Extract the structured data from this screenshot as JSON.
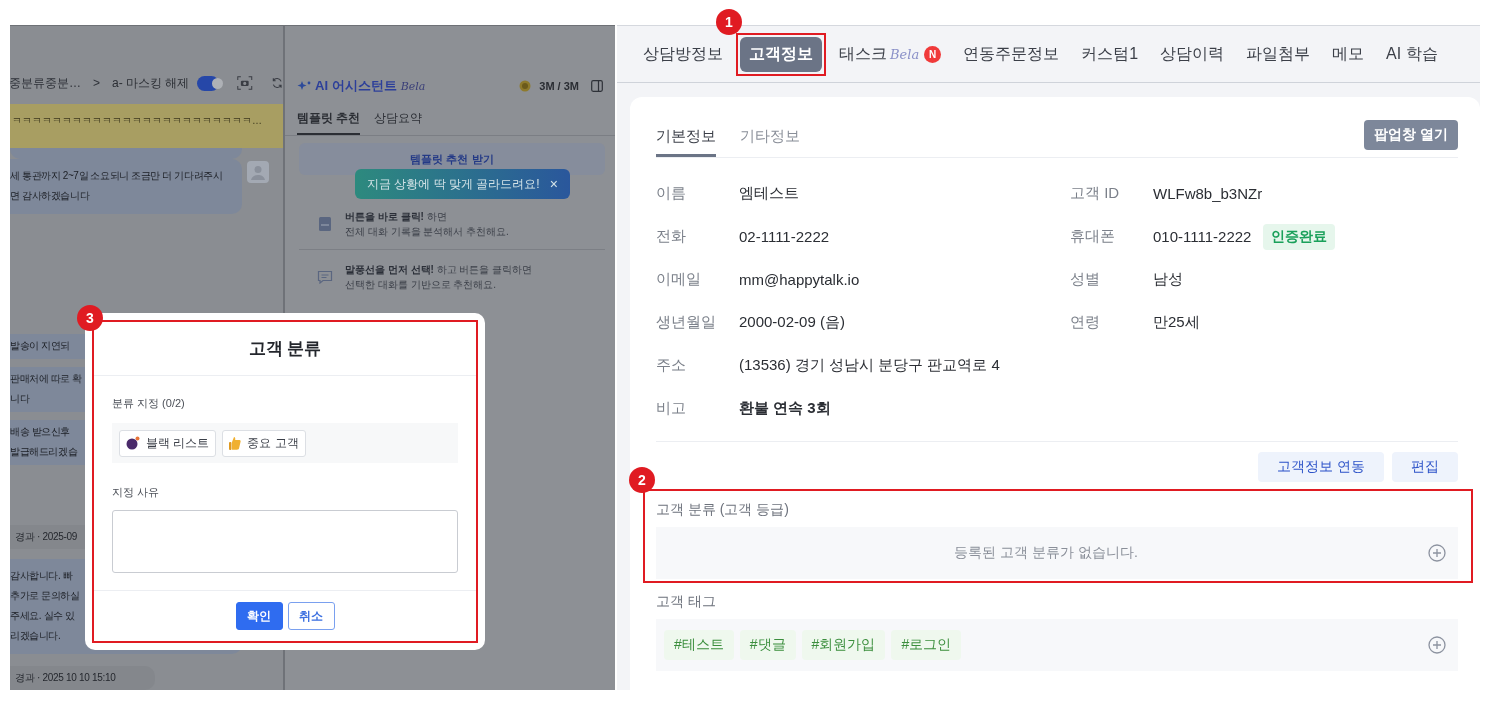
{
  "chat_panel": {
    "breadcrumb": "중분류중분…",
    "separator": ">",
    "masking_label": "a- 마스킹 해제",
    "masking_on": true,
    "banner": "ㅋㅋㅋㅋㅋㅋㅋㅋㅋㅋㅋㅋㅋㅋㅋㅋㅋㅋㅋㅋㅋㅋㅋㅋ…",
    "messages": [
      {
        "kind": "fragment"
      },
      {
        "kind": "agent",
        "lines": [
          "세 통관까지 2~7일 소요되니 조금만 더 기다려주시",
          "면 감사하겠습니다"
        ]
      },
      {
        "kind": "bubble",
        "lines": [
          "발송이 지연되"
        ]
      },
      {
        "kind": "bubble",
        "lines": [
          "판매처에 따로 확",
          "니다"
        ]
      },
      {
        "kind": "bubble",
        "lines": [
          "배송 받으신후",
          "발급해드리겠습"
        ]
      },
      {
        "kind": "time",
        "lines": [
          "경과 · 2025-09"
        ]
      },
      {
        "kind": "bubble",
        "lines": [
          "감사합니다. 빠",
          "추가로 문의하실",
          "주세요. 실수 있",
          "리겠습니다."
        ]
      },
      {
        "kind": "time",
        "lines": [
          "경과 · 2025 10 10 15:10"
        ]
      }
    ]
  },
  "ai_assistant": {
    "title": "AI 어시스턴트",
    "beta": "Bela",
    "quota": "3M / 3M",
    "tabs": [
      {
        "label": "템플릿 추천",
        "selected": true
      },
      {
        "label": "상담요약",
        "selected": false
      }
    ],
    "action": "템플릿 추천 받기",
    "tooltip": "지금 상황에 딱 맞게 골라드려요!",
    "tooltip_close": "×",
    "tips": [
      {
        "lines": [
          "**버튼을 바로 클릭!** 하면",
          "전체 대화 기록을 분석해서 추천해요."
        ]
      },
      {
        "lines": [
          "**말풍선을 먼저 선택!** 하고 버튼을 클릭하면",
          "선택한 대화를 기반으로 추천해요."
        ]
      }
    ]
  },
  "modal": {
    "callout": "3",
    "title": "고객 분류",
    "category_label": "분류 지정 (0/2)",
    "chips": [
      {
        "label": "블랙 리스트",
        "selected": false
      },
      {
        "label": "중요 고객",
        "selected": false
      }
    ],
    "reason_label": "지정 사유",
    "buttons": [
      {
        "label": "확인",
        "primary": true
      },
      {
        "label": "취소",
        "primary": false
      }
    ]
  },
  "tabs": [
    {
      "label": "상담방정보",
      "selected": false
    },
    {
      "label": "고객정보",
      "selected": true,
      "callout": "1"
    },
    {
      "label": "태스크",
      "beta": "Bela",
      "badge": "N",
      "selected": false
    },
    {
      "label": "연동주문정보",
      "selected": false
    },
    {
      "label": "커스텀1",
      "selected": false
    },
    {
      "label": "상담이력",
      "selected": false
    },
    {
      "label": "파일첨부",
      "selected": false
    },
    {
      "label": "메모",
      "selected": false
    },
    {
      "label": "AI 학습",
      "selected": false
    }
  ],
  "customer": {
    "subtabs": [
      {
        "label": "기본정보",
        "selected": true
      },
      {
        "label": "기타정보",
        "selected": false
      }
    ],
    "popup_button": "팝업창 열기",
    "rows": [
      [
        {
          "label": "이름",
          "value": "엠테스트"
        },
        {
          "label": "고객 ID",
          "value": "WLFw8b_b3NZr"
        }
      ],
      [
        {
          "label": "전화",
          "value": "02-1111-2222"
        },
        {
          "label": "휴대폰",
          "value": "010-1111-2222",
          "badge": "인증완료"
        }
      ],
      [
        {
          "label": "이메일",
          "value": "mm@happytalk.io"
        },
        {
          "label": "성별",
          "value": "남성"
        }
      ],
      [
        {
          "label": "생년월일",
          "value": "2000-02-09 (음)"
        },
        {
          "label": "연령",
          "value": "만25세"
        }
      ],
      [
        {
          "label": "주소",
          "value": "(13536) 경기 성남시 분당구 판교역로 4"
        }
      ],
      [
        {
          "label": "비고",
          "value": "환불 연속 3회",
          "bold": true
        }
      ]
    ],
    "actions": [
      "고객정보 연동",
      "편집"
    ],
    "classification": {
      "callout": "2",
      "label": "고객 분류 (고객 등급)",
      "empty": "등록된 고객 분류가 없습니다."
    },
    "tags": {
      "label": "고객 태그",
      "items": [
        "#테스트",
        "#댓글",
        "#회원가입",
        "#로그인"
      ]
    }
  }
}
